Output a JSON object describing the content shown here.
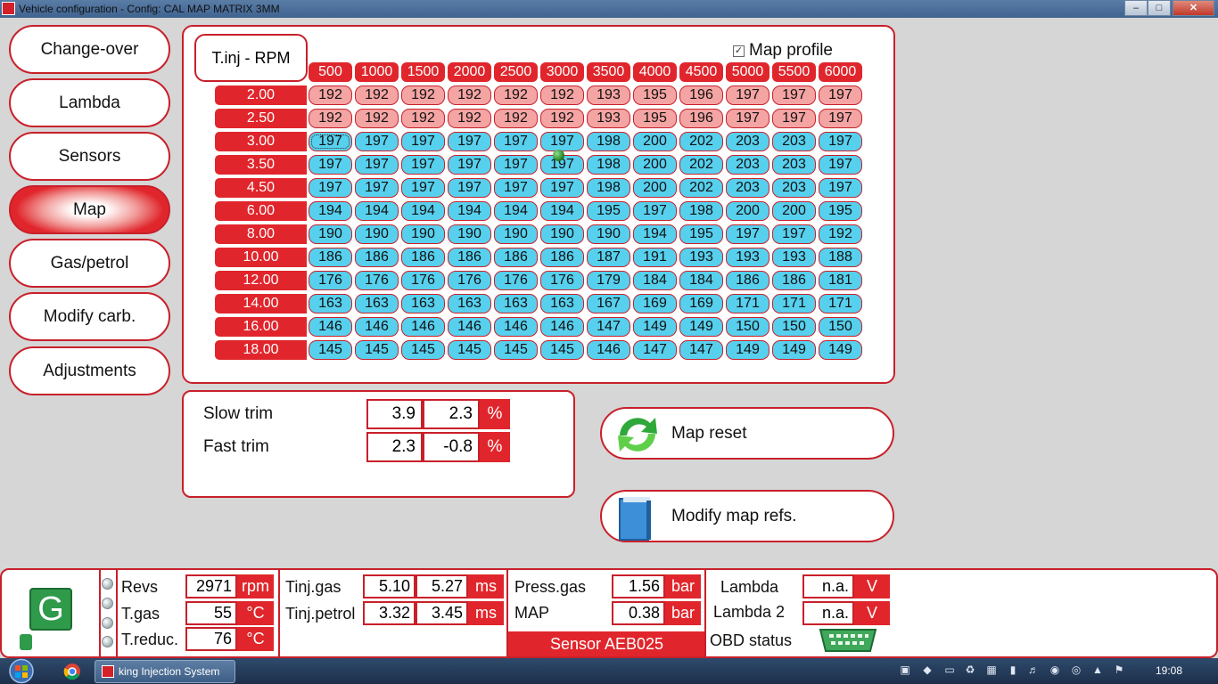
{
  "window": {
    "title": "Vehicle configuration - Config: CAL MAP MATRIX 3MM",
    "min": "‒",
    "max": "□",
    "close": "✕"
  },
  "nav": {
    "items": [
      {
        "label": "Change-over"
      },
      {
        "label": "Lambda"
      },
      {
        "label": "Sensors"
      },
      {
        "label": "Map",
        "active": true
      },
      {
        "label": "Gas/petrol"
      },
      {
        "label": "Modify carb."
      },
      {
        "label": "Adjustments"
      }
    ]
  },
  "map": {
    "corner_label": "T.inj - RPM",
    "profile_label": "Map profile",
    "profile_checked": true,
    "rpm": [
      "500",
      "1000",
      "1500",
      "2000",
      "2500",
      "3000",
      "3500",
      "4000",
      "4500",
      "5000",
      "5500",
      "6000"
    ],
    "tinj": [
      "2.00",
      "2.50",
      "3.00",
      "3.50",
      "4.50",
      "6.00",
      "8.00",
      "10.00",
      "12.00",
      "14.00",
      "16.00",
      "18.00"
    ],
    "cells": [
      [
        192,
        192,
        192,
        192,
        192,
        192,
        193,
        195,
        196,
        197,
        197,
        197
      ],
      [
        192,
        192,
        192,
        192,
        192,
        192,
        193,
        195,
        196,
        197,
        197,
        197
      ],
      [
        197,
        197,
        197,
        197,
        197,
        197,
        198,
        200,
        202,
        203,
        203,
        197
      ],
      [
        197,
        197,
        197,
        197,
        197,
        197,
        198,
        200,
        202,
        203,
        203,
        197
      ],
      [
        197,
        197,
        197,
        197,
        197,
        197,
        198,
        200,
        202,
        203,
        203,
        197
      ],
      [
        194,
        194,
        194,
        194,
        194,
        194,
        195,
        197,
        198,
        200,
        200,
        195
      ],
      [
        190,
        190,
        190,
        190,
        190,
        190,
        190,
        194,
        195,
        197,
        197,
        192
      ],
      [
        186,
        186,
        186,
        186,
        186,
        186,
        187,
        191,
        193,
        193,
        193,
        188
      ],
      [
        176,
        176,
        176,
        176,
        176,
        176,
        179,
        184,
        184,
        186,
        186,
        181
      ],
      [
        163,
        163,
        163,
        163,
        163,
        163,
        167,
        169,
        169,
        171,
        171,
        171
      ],
      [
        146,
        146,
        146,
        146,
        146,
        146,
        147,
        149,
        149,
        150,
        150,
        150
      ],
      [
        145,
        145,
        145,
        145,
        145,
        145,
        146,
        147,
        147,
        149,
        149,
        149
      ]
    ],
    "pink_rows": [
      0,
      1
    ],
    "colors": {
      "accent": "#e0262c",
      "pink": "#f4a4a3",
      "blue": "#57d0ee"
    }
  },
  "trim": {
    "slow": {
      "label": "Slow trim",
      "v1": "3.9",
      "v2": "2.3",
      "unit": "%"
    },
    "fast": {
      "label": "Fast trim",
      "v1": "2.3",
      "v2": "-0.8",
      "unit": "%"
    }
  },
  "actions": {
    "map_reset": "Map reset",
    "modify_refs": "Modify map refs."
  },
  "status": {
    "gas_indicator": "G",
    "revs": {
      "label": "Revs",
      "value": "2971",
      "unit": "rpm"
    },
    "tgas": {
      "label": "T.gas",
      "value": "55",
      "unit": "°C"
    },
    "treduc": {
      "label": "T.reduc.",
      "value": "76",
      "unit": "°C"
    },
    "tinj_gas": {
      "label": "Tinj.gas",
      "v1": "5.10",
      "v2": "5.27",
      "unit": "ms"
    },
    "tinj_petrol": {
      "label": "Tinj.petrol",
      "v1": "3.32",
      "v2": "3.45",
      "unit": "ms"
    },
    "press_gas": {
      "label": "Press.gas",
      "value": "1.56",
      "unit": "bar"
    },
    "map_value": {
      "label": "MAP",
      "value": "0.38",
      "unit": "bar"
    },
    "sensor": "Sensor AEB025",
    "lambda": {
      "label": "Lambda",
      "value": "n.a.",
      "unit": "V"
    },
    "lambda2": {
      "label": "Lambda 2",
      "value": "n.a.",
      "unit": "V"
    },
    "obd_label": "OBD status"
  },
  "taskbar": {
    "app_label": "king Injection System",
    "clock": "19:08"
  }
}
